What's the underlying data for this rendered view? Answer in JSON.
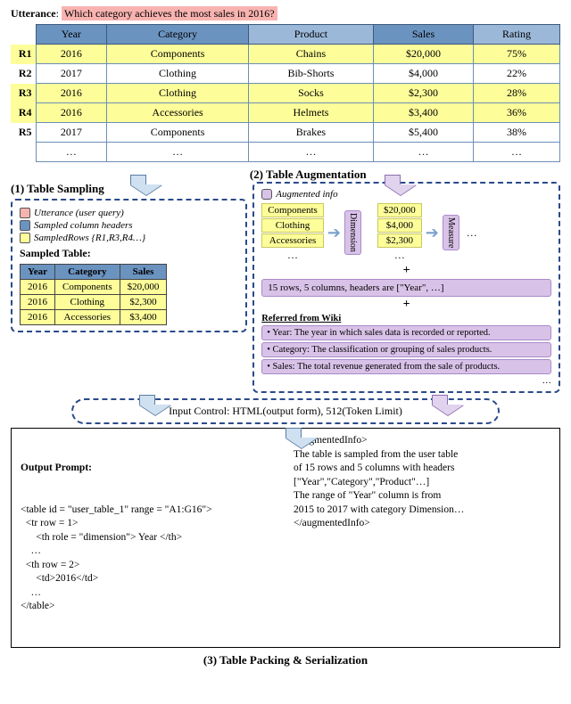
{
  "utterance": {
    "label": "Utterance",
    "text": "Which category achieves the most sales in 2016?"
  },
  "table": {
    "row_labels": [
      "R1",
      "R2",
      "R3",
      "R4",
      "R5",
      ""
    ],
    "headers": [
      "Year",
      "Category",
      "Product",
      "Sales",
      "Rating"
    ],
    "header_selected": [
      true,
      true,
      false,
      true,
      false
    ],
    "rows": [
      {
        "sel": true,
        "cells": [
          "2016",
          "Components",
          "Chains",
          "$20,000",
          "75%"
        ]
      },
      {
        "sel": false,
        "cells": [
          "2017",
          "Clothing",
          "Bib-Shorts",
          "$4,000",
          "22%"
        ]
      },
      {
        "sel": true,
        "cells": [
          "2016",
          "Clothing",
          "Socks",
          "$2,300",
          "28%"
        ]
      },
      {
        "sel": true,
        "cells": [
          "2016",
          "Accessories",
          "Helmets",
          "$3,400",
          "36%"
        ]
      },
      {
        "sel": false,
        "cells": [
          "2017",
          "Components",
          "Brakes",
          "$5,400",
          "38%"
        ]
      },
      {
        "sel": false,
        "cells": [
          "…",
          "…",
          "…",
          "…",
          "…"
        ]
      }
    ]
  },
  "steps": {
    "sampling": "(1) Table Sampling",
    "augment": "(2) Table Augmentation",
    "packing": "(3) Table Packing & Serialization"
  },
  "sampling": {
    "legend": {
      "utt": "Utterance (user query)",
      "cols": "Sampled column headers",
      "rows": "SampledRows {R1,R3,R4…}"
    },
    "sampled_label": "Sampled Table:",
    "mini_headers": [
      "Year",
      "Category",
      "Sales"
    ],
    "mini_rows": [
      [
        "2016",
        "Components",
        "$20,000"
      ],
      [
        "2016",
        "Clothing",
        "$2,300"
      ],
      [
        "2016",
        "Accessories",
        "$3,400"
      ]
    ]
  },
  "augment": {
    "legend": "Augmented info",
    "dim_vals": [
      "Components",
      "Clothing",
      "Accessories",
      "…"
    ],
    "dim_label": "Dimension",
    "meas_vals": [
      "$20,000",
      "$4,000",
      "$2,300",
      "…"
    ],
    "meas_label": "Measure",
    "ellipsis": "…",
    "meta": "15 rows, 5 columns, headers are [\"Year\", …]",
    "wiki_hdr": "Referred from Wiki",
    "wiki": [
      "• Year: The year in which sales data is recorded or reported.",
      "• Category: The classification or grouping of sales products.",
      "• Sales: The total revenue generated from the sale of products."
    ],
    "wiki_ellipsis": "…"
  },
  "input_control": "Input Control: HTML(output form), 512(Token Limit)",
  "output": {
    "title": "Output Prompt:",
    "left": "<table id = \"user_table_1\" range = \"A1:G16\">\n  <tr row = 1>\n      <th role = \"dimension\"> Year </th>\n    …\n  <th row = 2>\n      <td>2016</td>\n    …\n</table>",
    "right": "<augmentedInfo>\nThe table is sampled from the user table\nof 15 rows and 5 columns with headers\n[\"Year\",\"Category\",\"Product\"…]\nThe range of \"Year\" column is from\n2015 to 2017 with category Dimension…\n</augmentedInfo>"
  }
}
